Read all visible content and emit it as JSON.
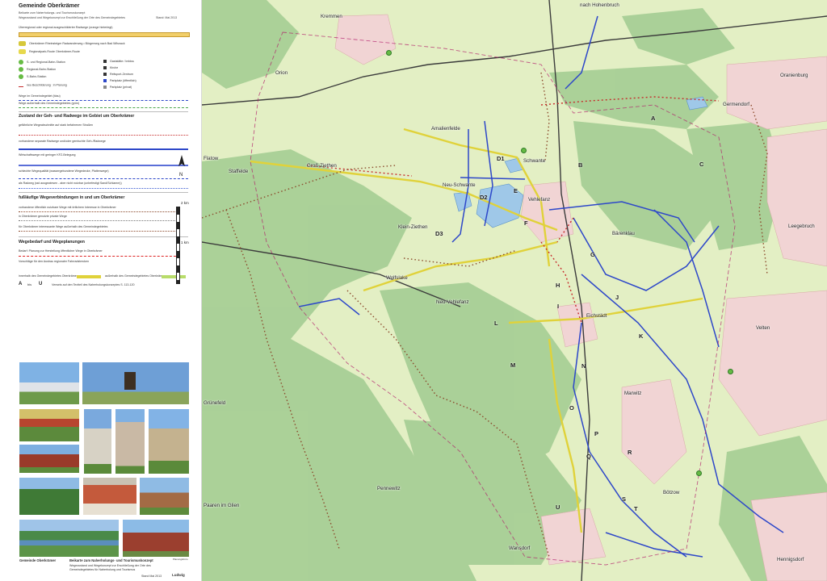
{
  "panel": {
    "title": "Gemeinde Oberkrämer",
    "subtitle_lines": [
      "Beikarte zum Naherholungs- und Tourismuskonzept",
      "Wegezustand und Wegekonzept zur Erschließung der Orte des Gemeindegebietes"
    ],
    "stand": "Stand: Mai 2013",
    "legend_general": [
      {
        "label": "Überregional oder regional ausgeschilderter Radwege (orange hinterlegt)",
        "kind": "highlight"
      },
      {
        "label": "Oberkrämer Rheinsteiger Radwanderweg • Bürgerweg nach Bad Wilsnack",
        "kind": "badge",
        "code": "ORR"
      },
      {
        "label": "Regionalpark-Route Oberkrämer-Route",
        "kind": "badge",
        "code": "RR"
      },
      {
        "label": "S- und Regional-Bahn-Station",
        "kind": "badge",
        "code": "S+R"
      },
      {
        "label": "Regional-Bahn-Station",
        "kind": "badge",
        "code": "R"
      },
      {
        "label": "S-Bahn-Station",
        "kind": "badge",
        "code": "S"
      },
      {
        "label": "neu Beschilderung : in Planung",
        "kind": "text"
      }
    ],
    "legend_right": [
      "Gaststätte / Imbiss",
      "Kirche",
      "Reitsport-Zentrum",
      "Parkplatz (öffentlich)",
      "Parkplatz (privat)"
    ],
    "legend_inside": [
      "Wege im Gemeindegebiet (blau)",
      "Wege außerhalb des Gemeindegebietes (grün)"
    ],
    "section_zustand": {
      "title": "Zustand der Geh- und Radwege im Gebiet um Oberkrämer",
      "items": [
        "gefährliche Wegeabschnitte auf stark befahrenen Straßen",
        "vorhandene separate Radwege und/oder gemischte Geh-/Radwege",
        "Wirtschaftswege mit geringer KFZ-Belegung",
        "schlechte Wegequalität (wassergebundene Wegedecke, Plattenwege)",
        "als Radweg (rad ausgewiesen - aber nicht nutzbar (unbefestigt Sand/Schlamm))"
      ]
    },
    "section_fuss": {
      "title": "fußläufige Wegeverbindungen in und um Oberkrämer",
      "items": [
        "vorhandene öffentlich nutzbare Wege mit örtlichem Interesse in Oberkrämer",
        "in Oberkrämer genutzte private Wege",
        "für Oberkrämer interessante Wege außerhalb des Gemeindegebietes"
      ]
    },
    "section_bedarf": {
      "title": "Wegebedarf und Wegeplanungen",
      "items": [
        "Bedarf: Planung zur Herstellung öffentlicher Wege in Oberkrämer",
        "Vorschläge für den Ausbau regionaler Fahrradstrecken",
        "innerhalb des Gemeindegebietes Oberkrämer",
        "außerhalb des Gemeindegebietes Oberkrämer"
      ]
    },
    "ab_note": {
      "from": "A",
      "mid": "bis",
      "to": "U",
      "text": "Verweis auf den Textteil des Naherholungskonzeptes S. 113-120"
    },
    "scale": {
      "top": "2 km",
      "bottom": "1 km"
    },
    "north": "N",
    "footer": {
      "left_title": "Gemeinde Oberkrämer",
      "center_title": "Beikarte zum Naherholungs- und Tourismuskonzept",
      "left_sub": "Wegezustand und Wegekonzept zur Erschließung der Orte des Gemeindegebietes für Naherholung und Tourismus",
      "stand": "Stand Mai 2013",
      "planungsburo": "Planungsbüro",
      "logo": "Ludwig"
    }
  },
  "map": {
    "places": [
      "Kremmen",
      "nach Hohenbruch",
      "Oranienburg",
      "Orion",
      "Germendorf",
      "Amalienfelde",
      "Flatow",
      "Staffelde",
      "Groß-Ziethen",
      "Schwante",
      "Neu-Schwante",
      "Vehlefanz",
      "Bärenklau",
      "Leegebruch",
      "Klein-Ziethen",
      "Wolfslake",
      "Neu-Vehlefanz",
      "Eichstädt",
      "Velten",
      "Grünefeld",
      "Marwitz",
      "Pennewitz",
      "Paaren im Glien",
      "Bötzow",
      "Wansdorf",
      "Hennigsdorf"
    ],
    "route_letters": [
      "A",
      "B",
      "C",
      "D1",
      "D2",
      "D3",
      "E",
      "F",
      "G",
      "H",
      "I",
      "J",
      "K",
      "L",
      "M",
      "N",
      "O",
      "P",
      "Q",
      "R",
      "S",
      "T",
      "U"
    ]
  },
  "colors": {
    "map_green": "#c8e2a6",
    "forest": "#8fbf82",
    "meadow": "#e6f0c9",
    "cycle_blue": "#2d47c9",
    "road_red": "#c62b2b",
    "path_brown": "#8b4a2c",
    "planned_yellow": "#e0d23a",
    "railway": "#3b3b3b"
  }
}
